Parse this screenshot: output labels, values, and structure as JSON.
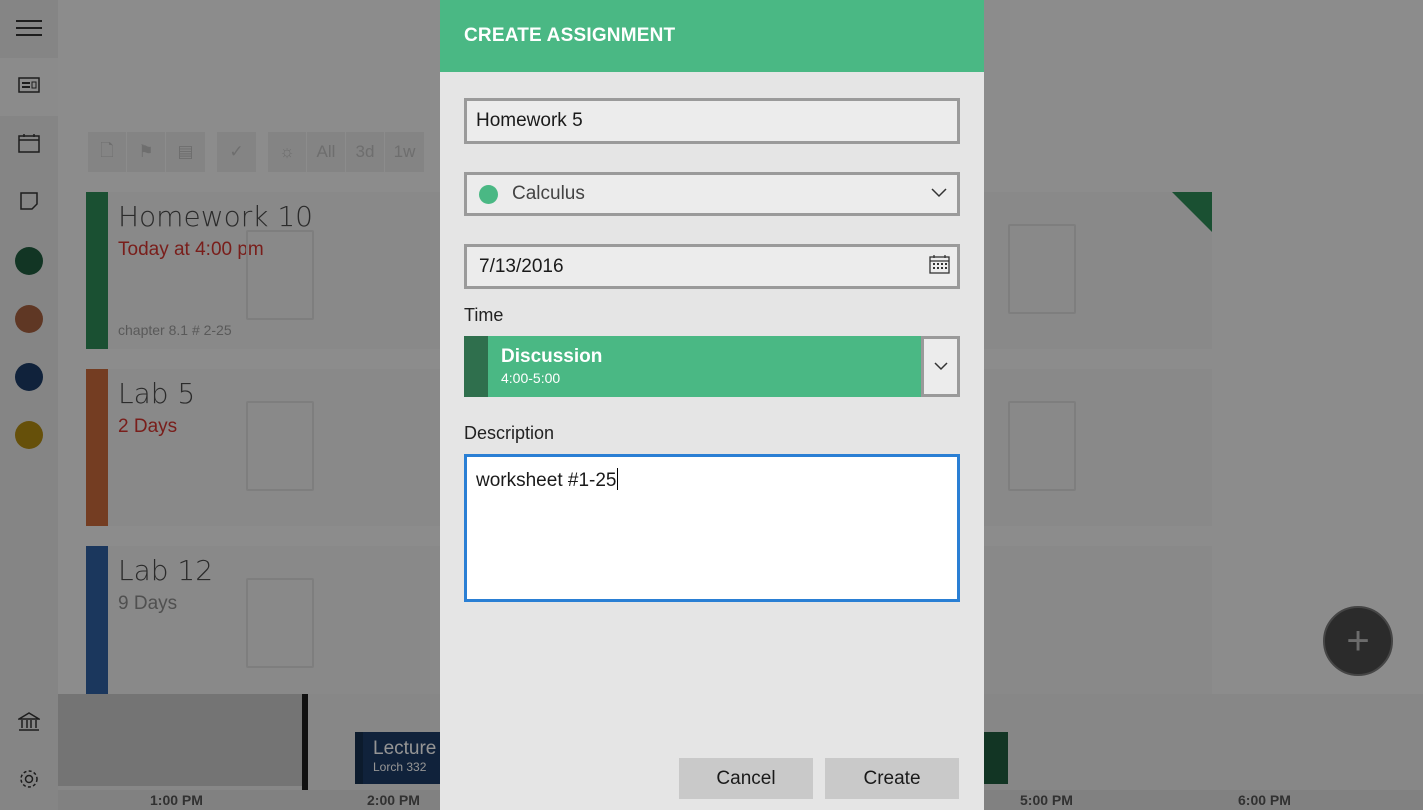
{
  "rail": {
    "dot_colors": [
      "#1f5c3e",
      "#a4603f",
      "#1d3c66",
      "#b08a12"
    ]
  },
  "toolbar": {
    "filters": [
      "All",
      "3d",
      "1w"
    ]
  },
  "cards": [
    {
      "title": "Homework 10",
      "due": "Today at 4:00 pm",
      "note": "chapter 8.1 # 2-25",
      "color": "#2e8b57"
    },
    {
      "title": "Lab 5",
      "due": "2 Days",
      "note": "",
      "color": "#c96a3c"
    },
    {
      "title": "Lab 12",
      "due": "9 Days",
      "note": "",
      "color": "#2f5fa0"
    }
  ],
  "timeline": {
    "labels": [
      "1:00 PM",
      "2:00 PM",
      "5:00 PM",
      "6:00 PM"
    ],
    "event": {
      "title": "Lecture",
      "location": "Lorch 332"
    }
  },
  "dialog": {
    "title": "CREATE ASSIGNMENT",
    "name_value": "Homework 5",
    "class_value": "Calculus",
    "class_color": "#4ab884",
    "date_value": "7/13/2016",
    "time_label": "Time",
    "time_slot": {
      "name": "Discussion",
      "range": "4:00-5:00"
    },
    "description_label": "Description",
    "description_value": "worksheet #1-25",
    "cancel_label": "Cancel",
    "create_label": "Create"
  }
}
